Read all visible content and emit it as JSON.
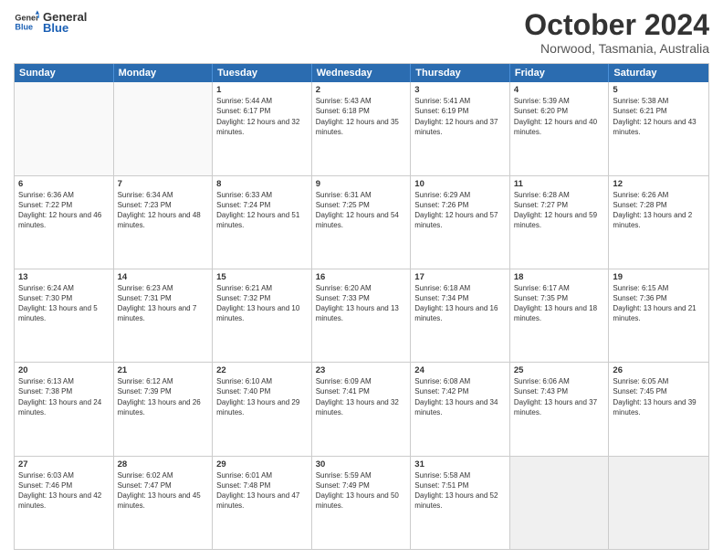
{
  "header": {
    "logo_general": "General",
    "logo_blue": "Blue",
    "title": "October 2024",
    "subtitle": "Norwood, Tasmania, Australia"
  },
  "calendar": {
    "days": [
      "Sunday",
      "Monday",
      "Tuesday",
      "Wednesday",
      "Thursday",
      "Friday",
      "Saturday"
    ],
    "weeks": [
      [
        {
          "date": "",
          "sunrise": "",
          "sunset": "",
          "daylight": "",
          "empty": true
        },
        {
          "date": "",
          "sunrise": "",
          "sunset": "",
          "daylight": "",
          "empty": true
        },
        {
          "date": "1",
          "sunrise": "Sunrise: 5:44 AM",
          "sunset": "Sunset: 6:17 PM",
          "daylight": "Daylight: 12 hours and 32 minutes."
        },
        {
          "date": "2",
          "sunrise": "Sunrise: 5:43 AM",
          "sunset": "Sunset: 6:18 PM",
          "daylight": "Daylight: 12 hours and 35 minutes."
        },
        {
          "date": "3",
          "sunrise": "Sunrise: 5:41 AM",
          "sunset": "Sunset: 6:19 PM",
          "daylight": "Daylight: 12 hours and 37 minutes."
        },
        {
          "date": "4",
          "sunrise": "Sunrise: 5:39 AM",
          "sunset": "Sunset: 6:20 PM",
          "daylight": "Daylight: 12 hours and 40 minutes."
        },
        {
          "date": "5",
          "sunrise": "Sunrise: 5:38 AM",
          "sunset": "Sunset: 6:21 PM",
          "daylight": "Daylight: 12 hours and 43 minutes."
        }
      ],
      [
        {
          "date": "6",
          "sunrise": "Sunrise: 6:36 AM",
          "sunset": "Sunset: 7:22 PM",
          "daylight": "Daylight: 12 hours and 46 minutes."
        },
        {
          "date": "7",
          "sunrise": "Sunrise: 6:34 AM",
          "sunset": "Sunset: 7:23 PM",
          "daylight": "Daylight: 12 hours and 48 minutes."
        },
        {
          "date": "8",
          "sunrise": "Sunrise: 6:33 AM",
          "sunset": "Sunset: 7:24 PM",
          "daylight": "Daylight: 12 hours and 51 minutes."
        },
        {
          "date": "9",
          "sunrise": "Sunrise: 6:31 AM",
          "sunset": "Sunset: 7:25 PM",
          "daylight": "Daylight: 12 hours and 54 minutes."
        },
        {
          "date": "10",
          "sunrise": "Sunrise: 6:29 AM",
          "sunset": "Sunset: 7:26 PM",
          "daylight": "Daylight: 12 hours and 57 minutes."
        },
        {
          "date": "11",
          "sunrise": "Sunrise: 6:28 AM",
          "sunset": "Sunset: 7:27 PM",
          "daylight": "Daylight: 12 hours and 59 minutes."
        },
        {
          "date": "12",
          "sunrise": "Sunrise: 6:26 AM",
          "sunset": "Sunset: 7:28 PM",
          "daylight": "Daylight: 13 hours and 2 minutes."
        }
      ],
      [
        {
          "date": "13",
          "sunrise": "Sunrise: 6:24 AM",
          "sunset": "Sunset: 7:30 PM",
          "daylight": "Daylight: 13 hours and 5 minutes."
        },
        {
          "date": "14",
          "sunrise": "Sunrise: 6:23 AM",
          "sunset": "Sunset: 7:31 PM",
          "daylight": "Daylight: 13 hours and 7 minutes."
        },
        {
          "date": "15",
          "sunrise": "Sunrise: 6:21 AM",
          "sunset": "Sunset: 7:32 PM",
          "daylight": "Daylight: 13 hours and 10 minutes."
        },
        {
          "date": "16",
          "sunrise": "Sunrise: 6:20 AM",
          "sunset": "Sunset: 7:33 PM",
          "daylight": "Daylight: 13 hours and 13 minutes."
        },
        {
          "date": "17",
          "sunrise": "Sunrise: 6:18 AM",
          "sunset": "Sunset: 7:34 PM",
          "daylight": "Daylight: 13 hours and 16 minutes."
        },
        {
          "date": "18",
          "sunrise": "Sunrise: 6:17 AM",
          "sunset": "Sunset: 7:35 PM",
          "daylight": "Daylight: 13 hours and 18 minutes."
        },
        {
          "date": "19",
          "sunrise": "Sunrise: 6:15 AM",
          "sunset": "Sunset: 7:36 PM",
          "daylight": "Daylight: 13 hours and 21 minutes."
        }
      ],
      [
        {
          "date": "20",
          "sunrise": "Sunrise: 6:13 AM",
          "sunset": "Sunset: 7:38 PM",
          "daylight": "Daylight: 13 hours and 24 minutes."
        },
        {
          "date": "21",
          "sunrise": "Sunrise: 6:12 AM",
          "sunset": "Sunset: 7:39 PM",
          "daylight": "Daylight: 13 hours and 26 minutes."
        },
        {
          "date": "22",
          "sunrise": "Sunrise: 6:10 AM",
          "sunset": "Sunset: 7:40 PM",
          "daylight": "Daylight: 13 hours and 29 minutes."
        },
        {
          "date": "23",
          "sunrise": "Sunrise: 6:09 AM",
          "sunset": "Sunset: 7:41 PM",
          "daylight": "Daylight: 13 hours and 32 minutes."
        },
        {
          "date": "24",
          "sunrise": "Sunrise: 6:08 AM",
          "sunset": "Sunset: 7:42 PM",
          "daylight": "Daylight: 13 hours and 34 minutes."
        },
        {
          "date": "25",
          "sunrise": "Sunrise: 6:06 AM",
          "sunset": "Sunset: 7:43 PM",
          "daylight": "Daylight: 13 hours and 37 minutes."
        },
        {
          "date": "26",
          "sunrise": "Sunrise: 6:05 AM",
          "sunset": "Sunset: 7:45 PM",
          "daylight": "Daylight: 13 hours and 39 minutes."
        }
      ],
      [
        {
          "date": "27",
          "sunrise": "Sunrise: 6:03 AM",
          "sunset": "Sunset: 7:46 PM",
          "daylight": "Daylight: 13 hours and 42 minutes."
        },
        {
          "date": "28",
          "sunrise": "Sunrise: 6:02 AM",
          "sunset": "Sunset: 7:47 PM",
          "daylight": "Daylight: 13 hours and 45 minutes."
        },
        {
          "date": "29",
          "sunrise": "Sunrise: 6:01 AM",
          "sunset": "Sunset: 7:48 PM",
          "daylight": "Daylight: 13 hours and 47 minutes."
        },
        {
          "date": "30",
          "sunrise": "Sunrise: 5:59 AM",
          "sunset": "Sunset: 7:49 PM",
          "daylight": "Daylight: 13 hours and 50 minutes."
        },
        {
          "date": "31",
          "sunrise": "Sunrise: 5:58 AM",
          "sunset": "Sunset: 7:51 PM",
          "daylight": "Daylight: 13 hours and 52 minutes."
        },
        {
          "date": "",
          "sunrise": "",
          "sunset": "",
          "daylight": "",
          "empty": true
        },
        {
          "date": "",
          "sunrise": "",
          "sunset": "",
          "daylight": "",
          "empty": true
        }
      ]
    ]
  }
}
